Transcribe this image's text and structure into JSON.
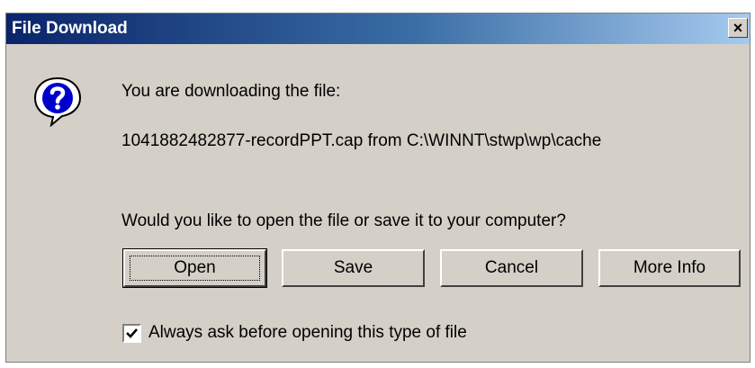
{
  "dialog": {
    "title": "File Download",
    "close_label": "×",
    "icon": "question-icon",
    "message_line1": "You are downloading the file:",
    "file_info": "1041882482877-recordPPT.cap from C:\\WINNT\\stwp\\wp\\cache",
    "prompt": "Would you like to open the file or save it to your computer?",
    "buttons": {
      "open": "Open",
      "save": "Save",
      "cancel": "Cancel",
      "more_info": "More Info"
    },
    "checkbox": {
      "label": "Always ask before opening this type of file",
      "checked": true
    }
  }
}
